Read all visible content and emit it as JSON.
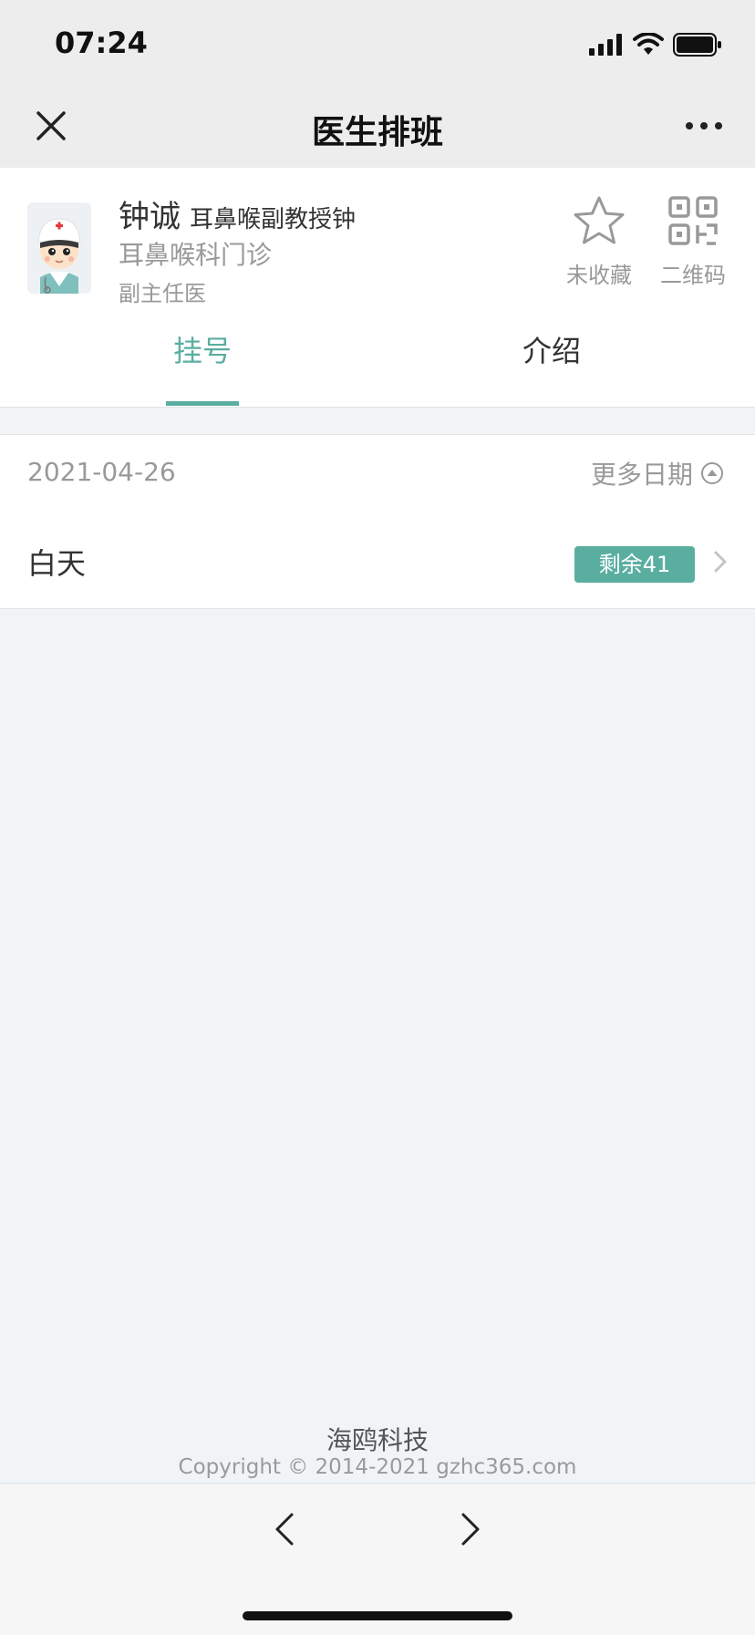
{
  "status_bar": {
    "time": "07:24"
  },
  "nav": {
    "title": "医生排班"
  },
  "doctor": {
    "name": "钟诚",
    "name_suffix": "耳鼻喉副教授钟",
    "department": "耳鼻喉科门诊",
    "rank": "副主任医",
    "favorite_label": "未收藏",
    "qrcode_label": "二维码"
  },
  "tabs": [
    {
      "label": "挂号",
      "active": true
    },
    {
      "label": "介绍",
      "active": false
    }
  ],
  "schedule": {
    "date": "2021-04-26",
    "more_dates_label": "更多日期",
    "slots": [
      {
        "label": "白天",
        "remaining": "剩余41"
      }
    ]
  },
  "footer": {
    "brand": "海鸥科技",
    "copyright": "Copyright © 2014-2021 gzhc365.com"
  },
  "colors": {
    "accent": "#5aaea0"
  }
}
